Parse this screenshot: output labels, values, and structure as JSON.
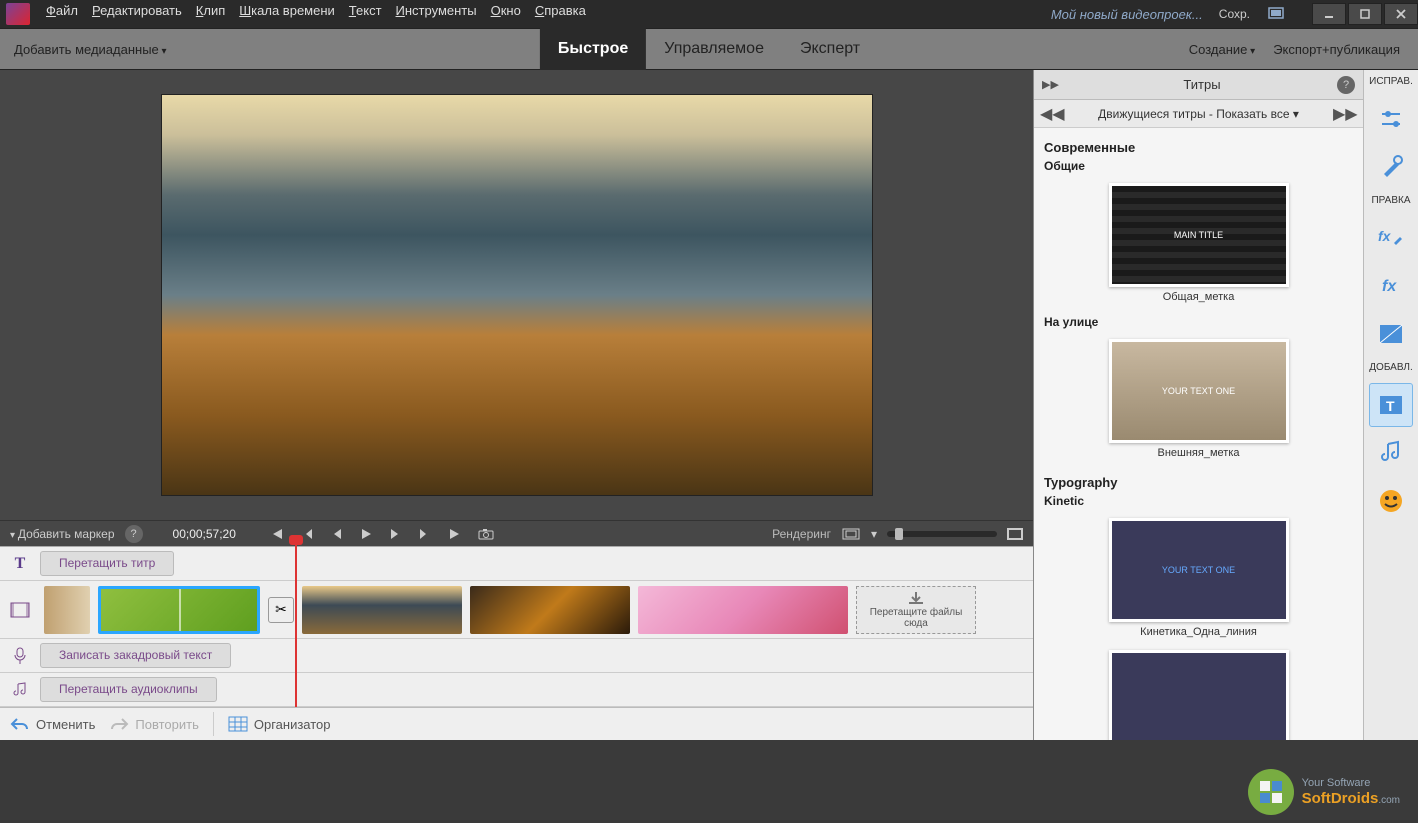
{
  "titlebar": {
    "project_title": "Мой новый видеопроек...",
    "save_label": "Сохр."
  },
  "menu": {
    "file": "Файл",
    "edit": "Редактировать",
    "clip": "Клип",
    "timeline": "Шкала времени",
    "text": "Текст",
    "tools": "Инструменты",
    "window": "Окно",
    "help": "Справка"
  },
  "modebar": {
    "add_media": "Добавить медиаданные",
    "tabs": {
      "quick": "Быстрое",
      "guided": "Управляемое",
      "expert": "Эксперт"
    },
    "create": "Создание",
    "export": "Экспорт+публикация"
  },
  "transport": {
    "add_marker": "Добавить маркер",
    "timecode": "00;00;57;20",
    "rendering": "Рендеринг"
  },
  "timeline": {
    "drag_title": "Перетащить титр",
    "record_voice": "Записать закадровый текст",
    "drag_audio": "Перетащить аудиоклипы",
    "dropzone": "Перетащите файлы сюда"
  },
  "bottombar": {
    "undo": "Отменить",
    "redo": "Повторить",
    "organizer": "Организатор"
  },
  "panel": {
    "title": "Титры",
    "sub_title": "Движущиеся титры - Показать все ▾",
    "fix_label": "ИСПРАВ.",
    "cat_modern": "Современные",
    "sub_general": "Общие",
    "card1": "Общая_метка",
    "sub_outdoor": "На улице",
    "card2": "Внешняя_метка",
    "cat_typo": "Typography",
    "sub_kinetic": "Kinetic",
    "card3": "Кинетика_Одна_линия",
    "thumb1_text": "MAIN TITLE",
    "thumb2_text": "YOUR TEXT ONE",
    "thumb3_text": "YOUR TEXT ONE"
  },
  "rail": {
    "pravka": "ПРАВКА",
    "dobavl": "ДОБАВЛ."
  },
  "watermark": {
    "tag": "Your Software",
    "brand1": "Soft",
    "brand2": "Droids",
    "suffix": ".com"
  }
}
